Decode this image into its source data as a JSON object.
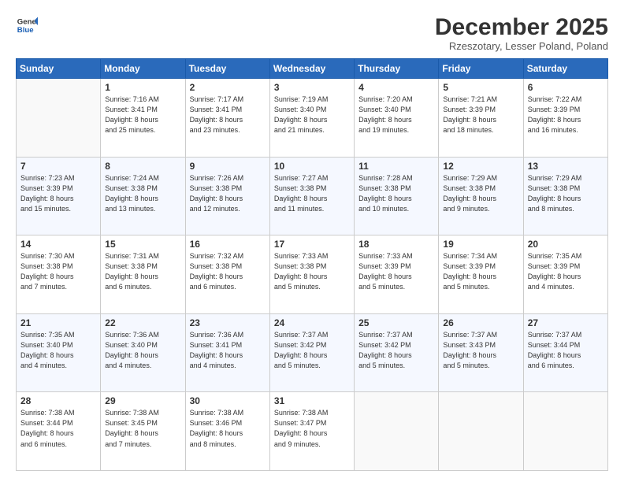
{
  "header": {
    "logo_line1": "General",
    "logo_line2": "Blue",
    "month": "December 2025",
    "location": "Rzeszotary, Lesser Poland, Poland"
  },
  "weekdays": [
    "Sunday",
    "Monday",
    "Tuesday",
    "Wednesday",
    "Thursday",
    "Friday",
    "Saturday"
  ],
  "weeks": [
    [
      {
        "day": "",
        "info": ""
      },
      {
        "day": "1",
        "info": "Sunrise: 7:16 AM\nSunset: 3:41 PM\nDaylight: 8 hours\nand 25 minutes."
      },
      {
        "day": "2",
        "info": "Sunrise: 7:17 AM\nSunset: 3:41 PM\nDaylight: 8 hours\nand 23 minutes."
      },
      {
        "day": "3",
        "info": "Sunrise: 7:19 AM\nSunset: 3:40 PM\nDaylight: 8 hours\nand 21 minutes."
      },
      {
        "day": "4",
        "info": "Sunrise: 7:20 AM\nSunset: 3:40 PM\nDaylight: 8 hours\nand 19 minutes."
      },
      {
        "day": "5",
        "info": "Sunrise: 7:21 AM\nSunset: 3:39 PM\nDaylight: 8 hours\nand 18 minutes."
      },
      {
        "day": "6",
        "info": "Sunrise: 7:22 AM\nSunset: 3:39 PM\nDaylight: 8 hours\nand 16 minutes."
      }
    ],
    [
      {
        "day": "7",
        "info": "Sunrise: 7:23 AM\nSunset: 3:39 PM\nDaylight: 8 hours\nand 15 minutes."
      },
      {
        "day": "8",
        "info": "Sunrise: 7:24 AM\nSunset: 3:38 PM\nDaylight: 8 hours\nand 13 minutes."
      },
      {
        "day": "9",
        "info": "Sunrise: 7:26 AM\nSunset: 3:38 PM\nDaylight: 8 hours\nand 12 minutes."
      },
      {
        "day": "10",
        "info": "Sunrise: 7:27 AM\nSunset: 3:38 PM\nDaylight: 8 hours\nand 11 minutes."
      },
      {
        "day": "11",
        "info": "Sunrise: 7:28 AM\nSunset: 3:38 PM\nDaylight: 8 hours\nand 10 minutes."
      },
      {
        "day": "12",
        "info": "Sunrise: 7:29 AM\nSunset: 3:38 PM\nDaylight: 8 hours\nand 9 minutes."
      },
      {
        "day": "13",
        "info": "Sunrise: 7:29 AM\nSunset: 3:38 PM\nDaylight: 8 hours\nand 8 minutes."
      }
    ],
    [
      {
        "day": "14",
        "info": "Sunrise: 7:30 AM\nSunset: 3:38 PM\nDaylight: 8 hours\nand 7 minutes."
      },
      {
        "day": "15",
        "info": "Sunrise: 7:31 AM\nSunset: 3:38 PM\nDaylight: 8 hours\nand 6 minutes."
      },
      {
        "day": "16",
        "info": "Sunrise: 7:32 AM\nSunset: 3:38 PM\nDaylight: 8 hours\nand 6 minutes."
      },
      {
        "day": "17",
        "info": "Sunrise: 7:33 AM\nSunset: 3:38 PM\nDaylight: 8 hours\nand 5 minutes."
      },
      {
        "day": "18",
        "info": "Sunrise: 7:33 AM\nSunset: 3:39 PM\nDaylight: 8 hours\nand 5 minutes."
      },
      {
        "day": "19",
        "info": "Sunrise: 7:34 AM\nSunset: 3:39 PM\nDaylight: 8 hours\nand 5 minutes."
      },
      {
        "day": "20",
        "info": "Sunrise: 7:35 AM\nSunset: 3:39 PM\nDaylight: 8 hours\nand 4 minutes."
      }
    ],
    [
      {
        "day": "21",
        "info": "Sunrise: 7:35 AM\nSunset: 3:40 PM\nDaylight: 8 hours\nand 4 minutes."
      },
      {
        "day": "22",
        "info": "Sunrise: 7:36 AM\nSunset: 3:40 PM\nDaylight: 8 hours\nand 4 minutes."
      },
      {
        "day": "23",
        "info": "Sunrise: 7:36 AM\nSunset: 3:41 PM\nDaylight: 8 hours\nand 4 minutes."
      },
      {
        "day": "24",
        "info": "Sunrise: 7:37 AM\nSunset: 3:42 PM\nDaylight: 8 hours\nand 5 minutes."
      },
      {
        "day": "25",
        "info": "Sunrise: 7:37 AM\nSunset: 3:42 PM\nDaylight: 8 hours\nand 5 minutes."
      },
      {
        "day": "26",
        "info": "Sunrise: 7:37 AM\nSunset: 3:43 PM\nDaylight: 8 hours\nand 5 minutes."
      },
      {
        "day": "27",
        "info": "Sunrise: 7:37 AM\nSunset: 3:44 PM\nDaylight: 8 hours\nand 6 minutes."
      }
    ],
    [
      {
        "day": "28",
        "info": "Sunrise: 7:38 AM\nSunset: 3:44 PM\nDaylight: 8 hours\nand 6 minutes."
      },
      {
        "day": "29",
        "info": "Sunrise: 7:38 AM\nSunset: 3:45 PM\nDaylight: 8 hours\nand 7 minutes."
      },
      {
        "day": "30",
        "info": "Sunrise: 7:38 AM\nSunset: 3:46 PM\nDaylight: 8 hours\nand 8 minutes."
      },
      {
        "day": "31",
        "info": "Sunrise: 7:38 AM\nSunset: 3:47 PM\nDaylight: 8 hours\nand 9 minutes."
      },
      {
        "day": "",
        "info": ""
      },
      {
        "day": "",
        "info": ""
      },
      {
        "day": "",
        "info": ""
      }
    ]
  ]
}
